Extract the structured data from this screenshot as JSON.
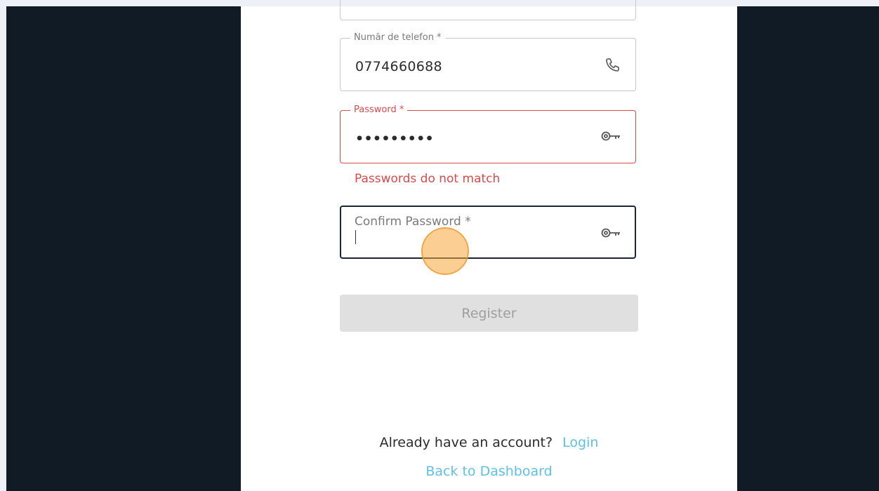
{
  "form": {
    "phone": {
      "label": "Număr de telefon *",
      "value": "0774660688",
      "icon": "phone-icon"
    },
    "password": {
      "label": "Password *",
      "value": "•••••••••",
      "icon": "key-icon",
      "error": "Passwords do not match"
    },
    "confirm_password": {
      "label": "Confirm Password *",
      "value": "",
      "icon": "key-icon"
    },
    "register_label": "Register"
  },
  "footer": {
    "question": "Already have an account?",
    "login_link": "Login",
    "dashboard_link": "Back to Dashboard"
  },
  "colors": {
    "error": "#d94a4a",
    "link": "#5ec0e8",
    "backdrop": "#111b25",
    "cursor_highlight": "#f7a83a"
  }
}
